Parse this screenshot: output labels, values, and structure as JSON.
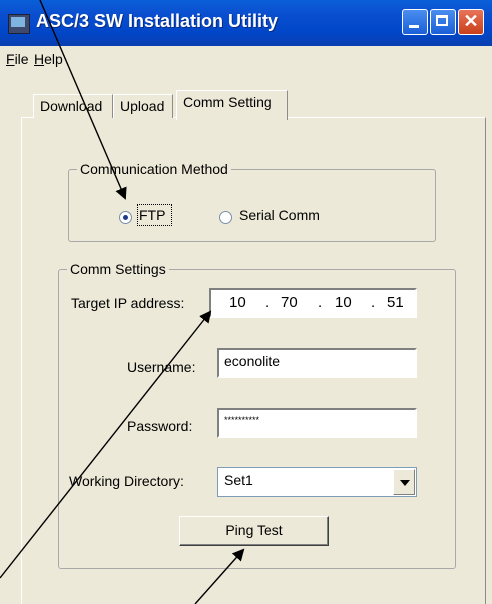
{
  "window": {
    "title": "ASC/3 SW Installation Utility"
  },
  "menu": {
    "file": {
      "mnemonic": "F",
      "rest": "ile"
    },
    "help": {
      "mnemonic": "H",
      "rest": "elp"
    }
  },
  "tabs": [
    {
      "label": "Download"
    },
    {
      "label": "Upload"
    },
    {
      "label": "Comm Setting"
    }
  ],
  "comm_method": {
    "title": "Communication Method",
    "ftp_label": "FTP",
    "serial_label": "Serial Comm",
    "selected": "FTP"
  },
  "comm_settings": {
    "title": "Comm Settings",
    "ip_label": "Target IP address:",
    "ip_octets": [
      "10",
      "70",
      "10",
      "51"
    ],
    "ip_dots": ".",
    "username_label": "Username:",
    "username_value": "econolite",
    "password_label": "Password:",
    "password_value": "**********",
    "working_dir_label": "Working Directory:",
    "working_dir_value": "Set1",
    "ping_button": "Ping Test"
  },
  "icons": {
    "app": "app-icon",
    "minimize": "minimize-icon",
    "maximize": "maximize-icon",
    "close": "close-icon",
    "dropdown": "chevron-down-icon"
  },
  "colors": {
    "titlebar": "#0a4fd0",
    "face": "#ece9d8",
    "close": "#c8401a",
    "annotation": "#000000"
  }
}
